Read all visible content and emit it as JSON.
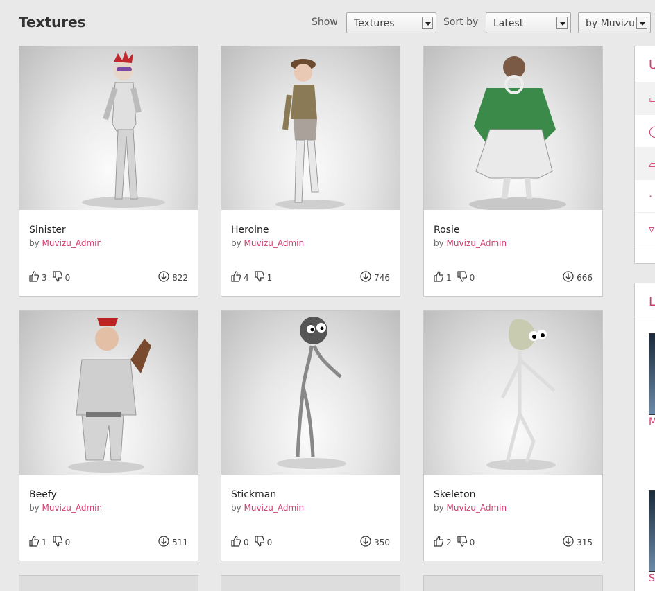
{
  "page_title": "Textures",
  "filters": {
    "show_label": "Show",
    "show_value": "Textures",
    "sort_label": "Sort by",
    "sort_value": "Latest",
    "by_value": "by Muvizu"
  },
  "cards": [
    {
      "title": "Sinister",
      "by": "by",
      "author": "Muvizu_Admin",
      "likes": "3",
      "dislikes": "0",
      "downloads": "822"
    },
    {
      "title": "Heroine",
      "by": "by",
      "author": "Muvizu_Admin",
      "likes": "4",
      "dislikes": "1",
      "downloads": "746"
    },
    {
      "title": "Rosie",
      "by": "by",
      "author": "Muvizu_Admin",
      "likes": "1",
      "dislikes": "0",
      "downloads": "666"
    },
    {
      "title": "Beefy",
      "by": "by",
      "author": "Muvizu_Admin",
      "likes": "1",
      "dislikes": "0",
      "downloads": "511"
    },
    {
      "title": "Stickman",
      "by": "by",
      "author": "Muvizu_Admin",
      "likes": "0",
      "dislikes": "0",
      "downloads": "350"
    },
    {
      "title": "Skeleton",
      "by": "by",
      "author": "Muvizu_Admin",
      "likes": "2",
      "dislikes": "0",
      "downloads": "315"
    }
  ],
  "sidebar": {
    "panel1_head": "U",
    "panel2_head": "L",
    "link1": "M",
    "link2": "S"
  },
  "colors": {
    "accent": "#d23c6d",
    "background": "#e9e9e9"
  }
}
